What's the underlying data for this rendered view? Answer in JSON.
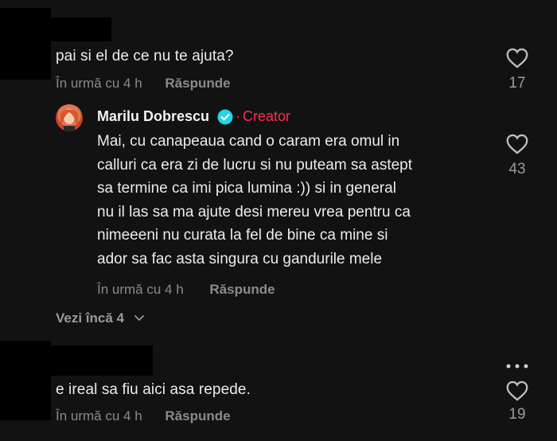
{
  "comments": [
    {
      "text": "pai si el de ce nu te ajuta?",
      "time": "În urmă cu 4 h",
      "reply_label": "Răspunde",
      "likes": "17"
    },
    {
      "text": "e ireal sa fiu aici asa repede.",
      "time": "În urmă cu 4 h",
      "reply_label": "Răspunde",
      "likes": "19"
    }
  ],
  "reply": {
    "author": "Marilu Dobrescu",
    "separator": "·",
    "badge": "Creator",
    "lines": [
      "Mai, cu canapeaua cand o caram era omul in",
      "calluri ca era zi de lucru si nu puteam sa astept",
      "sa termine ca imi pica lumina :)) si in general",
      "nu il las sa ma ajute desi mereu vrea pentru ca",
      "nimeeeni nu curata la fel de bine ca mine si",
      "ador sa fac asta singura cu gandurile mele"
    ],
    "time": "În urmă cu 4 h",
    "reply_label": "Răspunde",
    "likes": "43"
  },
  "view_more": "Vezi încă 4",
  "colors": {
    "background": "#121212",
    "creator_accent": "#fe2c55",
    "verified": "#20d5ec"
  },
  "icons": [
    "heart-icon",
    "verified-icon",
    "chevron-down-icon",
    "more-options-icon"
  ]
}
